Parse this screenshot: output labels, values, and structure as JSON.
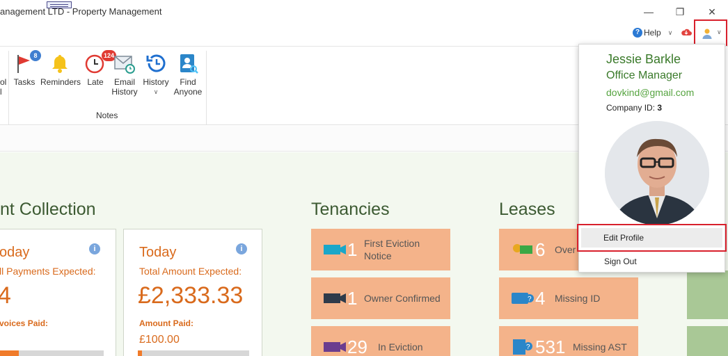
{
  "window": {
    "title": "anagement LTD - Property Management",
    "minimize": "—",
    "maximize": "❐",
    "close": "✕"
  },
  "toprow": {
    "help_label": "Help"
  },
  "ribbon": {
    "partial_left_line1": "ol",
    "partial_left_line2": "l",
    "items": [
      {
        "label": "Tasks",
        "badge": "8"
      },
      {
        "label": "Reminders"
      },
      {
        "label": "Late",
        "badge": "124"
      },
      {
        "label": "Email\nHistory"
      },
      {
        "label": "History"
      },
      {
        "label": "Find\nAnyone"
      }
    ],
    "group_label": "Notes"
  },
  "dashboard": {
    "rent_collection_title": "nt Collection",
    "card1": {
      "heading": "oday",
      "sub": "ll Payments Expected:",
      "big": "4",
      "paid_label": "voices Paid:"
    },
    "card2": {
      "heading": "Today",
      "sub": "Total Amount Expected:",
      "big": "£2,333.33",
      "paid_label": "Amount Paid:",
      "paid_value": "£100.00",
      "progress": 0.04
    },
    "tenancies_title": "Tenancies",
    "tenancies": [
      {
        "count": "1",
        "label": "First Eviction\nNotice",
        "color": "#1aa7c9"
      },
      {
        "count": "1",
        "label": "Owner Confirmed",
        "color": "#2f3b4a"
      },
      {
        "count": "29",
        "label": "In Eviction",
        "color": "#6b3d8f"
      }
    ],
    "leases_title": "Leases",
    "leases": [
      {
        "count": "6",
        "label": "Over"
      },
      {
        "count": "4",
        "label": "Missing ID"
      },
      {
        "count": "531",
        "label": "Missing AST"
      }
    ]
  },
  "user_menu": {
    "name": "Jessie Barkle",
    "role": "Office Manager",
    "email": "dovkind@gmail.com",
    "company_label": "Company ID:",
    "company_id": "3",
    "edit_profile": "Edit Profile",
    "sign_out": "Sign Out"
  },
  "colors": {
    "accent_green": "#3a7a2a",
    "accent_orange": "#d96a1c",
    "highlight_red": "#d8202c",
    "tile_orange": "#f4b38a"
  }
}
